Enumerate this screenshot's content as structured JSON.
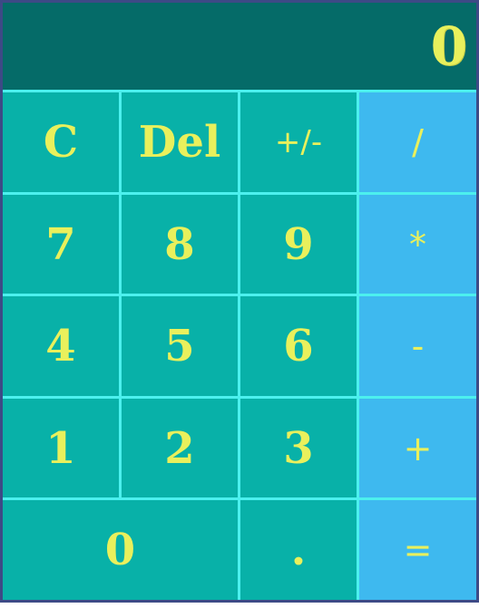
{
  "display": {
    "value": "0"
  },
  "keys": {
    "clear": "C",
    "delete": "Del",
    "negate": "+/-",
    "divide": "/",
    "seven": "7",
    "eight": "8",
    "nine": "9",
    "multiply": "*",
    "four": "4",
    "five": "5",
    "six": "6",
    "subtract": "-",
    "one": "1",
    "two": "2",
    "three": "3",
    "add": "+",
    "zero": "0",
    "decimal": ".",
    "equals": "="
  },
  "colors": {
    "display_bg": "#056b68",
    "key_bg": "#08b1a8",
    "operator_bg": "#3eb9ef",
    "grid_lines": "#4cf0ee",
    "text": "#e9f05c",
    "frame": "#3d4a86"
  }
}
